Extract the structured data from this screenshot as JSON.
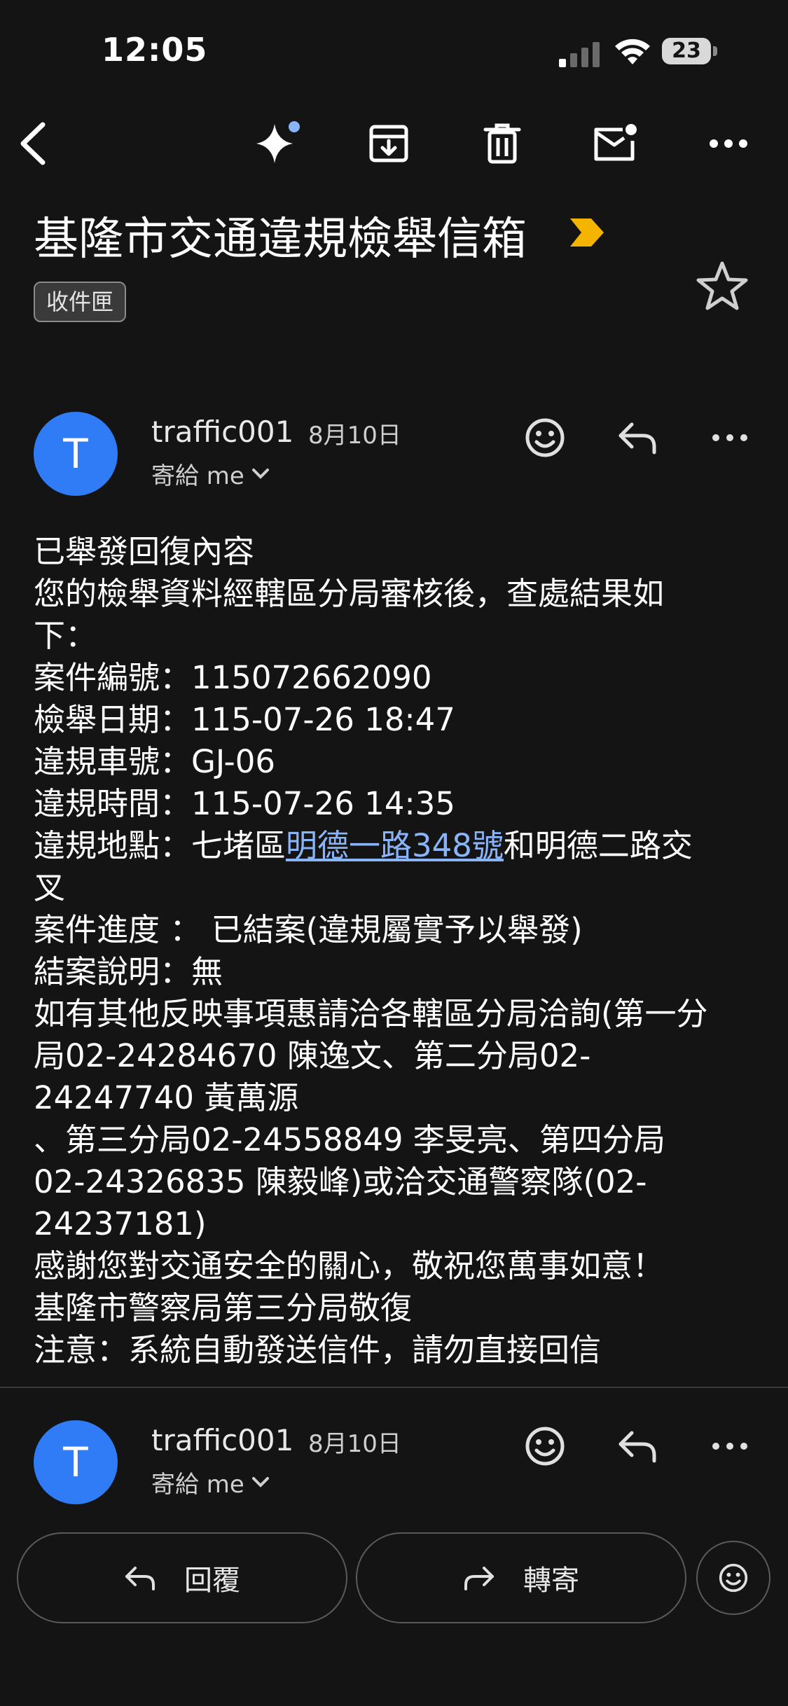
{
  "status_bar": {
    "time": "12:05",
    "battery": "23"
  },
  "toolbar": {
    "back": "back-arrow-icon",
    "gemini": "sparkle-icon",
    "archive": "archive-icon",
    "delete": "trash-icon",
    "mark_unread": "mail-unread-icon",
    "more": "more-horizontal-icon"
  },
  "email": {
    "subject": "基隆市交通違規檢舉信箱",
    "label": "收件匣",
    "messages": [
      {
        "avatar_letter": "T",
        "sender": "traffic001",
        "date": "8月10日",
        "to": "寄給 me"
      },
      {
        "avatar_letter": "T",
        "sender": "traffic001",
        "date": "8月10日",
        "to": "寄給 me"
      }
    ],
    "body": {
      "l1": "已舉發回復內容",
      "l2": "您的檢舉資料經轄區分局審核後，查處結果如",
      "l3": "下：",
      "l4": "案件編號：115072662090",
      "l5": "檢舉日期：115-07-26 18:47",
      "l6": "違規車號：GJ-06",
      "l7": "違規時間：115-07-26 14:35",
      "l8_prefix": "違規地點：七堵區",
      "l8_link": "明德一路348號",
      "l8_suffix": "和明德二路交",
      "l9": "叉",
      "l10": "案件進度 ： 已結案(違規屬實予以舉發)",
      "l11": "結案說明：無",
      "l12": "如有其他反映事項惠請洽各轄區分局洽詢(第一分",
      "l13": "局02-24284670 陳逸文、第二分局02-",
      "l14": "24247740 黃萬源",
      "l15": "、第三分局02-24558849 李旻亮、第四分局",
      "l16": "02-24326835 陳毅峰)或洽交通警察隊(02-",
      "l17": "24237181)",
      "l18": "感謝您對交通安全的關心，敬祝您萬事如意！",
      "l19": "基隆市警察局第三分局敬復",
      "l20": "注意：系統自動發送信件，請勿直接回信"
    }
  },
  "actions": {
    "reply": "回覆",
    "forward": "轉寄"
  },
  "colors": {
    "accent": "#2f7cf6",
    "link": "#8ab4f8",
    "importance": "#f4b400",
    "background": "#141414"
  }
}
